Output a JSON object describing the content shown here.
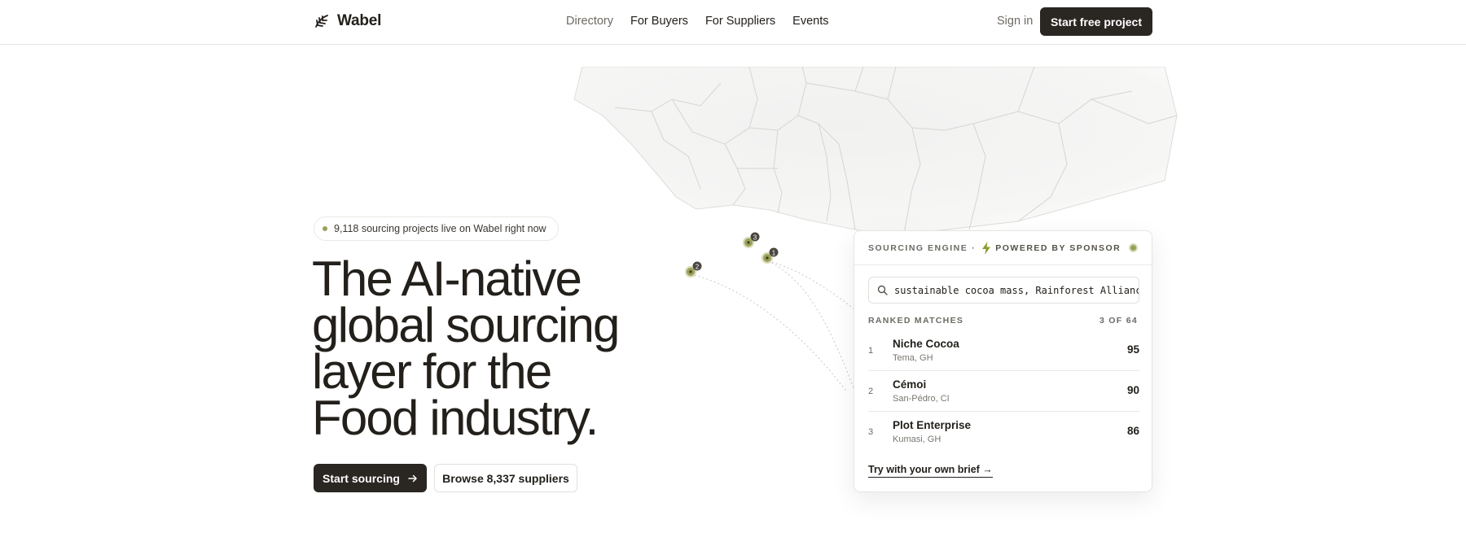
{
  "brand": {
    "name": "Wabel"
  },
  "nav": {
    "links": [
      "Directory",
      "For Buyers",
      "For Suppliers",
      "Events"
    ],
    "signin": "Sign in",
    "cta": "Start free project"
  },
  "hero": {
    "badge": "9,118 sourcing projects live on Wabel right now",
    "headline": [
      "The AI-native",
      "global sourcing",
      "layer for the",
      "Food industry."
    ],
    "primary_cta": "Start sourcing",
    "primary_cta_icon": "arrow-right-icon",
    "secondary_cta": "Browse 8,337 suppliers"
  },
  "map": {
    "markers": [
      "1",
      "2",
      "3"
    ]
  },
  "card": {
    "engine_label": "SOURCING ENGINE",
    "separator": "·",
    "sponsor_label": "POWERED BY SPONSOR",
    "search_value": "sustainable cocoa mass, Rainforest Alliance",
    "ranked_label": "RANKED MATCHES",
    "ranked_count": "3 OF 64",
    "results": [
      {
        "rank": "1",
        "name": "Niche Cocoa",
        "location": "Tema, GH",
        "score": "95"
      },
      {
        "rank": "2",
        "name": "Cémoi",
        "location": "San-Pédro, CI",
        "score": "90"
      },
      {
        "rank": "3",
        "name": "Plot Enterprise",
        "location": "Kumasi, GH",
        "score": "86"
      }
    ],
    "try_link": "Try with your own brief →"
  },
  "colors": {
    "ink": "#23201c",
    "accent_olive": "#9aa05a",
    "bolt": "#8f9a2e"
  }
}
